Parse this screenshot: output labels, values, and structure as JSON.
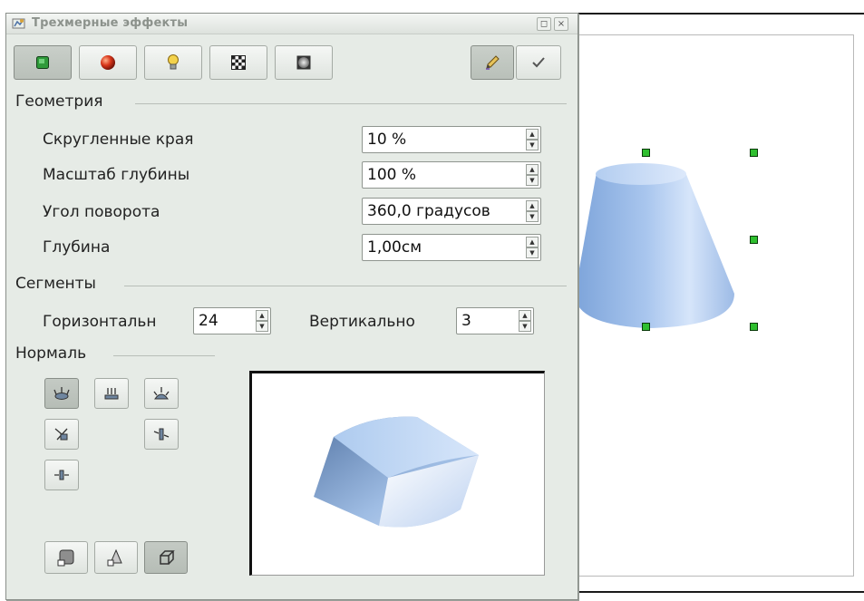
{
  "dialog": {
    "title": "Трехмерные эффекты",
    "window_buttons": {
      "restore": "◻",
      "close": "×"
    }
  },
  "toolbar": {
    "tabs": [
      {
        "name": "geometry",
        "icon": "cube-green-icon",
        "active": true
      },
      {
        "name": "shading",
        "icon": "sphere-red-icon",
        "active": false
      },
      {
        "name": "illumination",
        "icon": "lightbulb-icon",
        "active": false
      },
      {
        "name": "textures",
        "icon": "checker-texture-icon",
        "active": false
      },
      {
        "name": "material",
        "icon": "material-sphere-icon",
        "active": false
      }
    ],
    "right_buttons": [
      {
        "name": "update",
        "icon": "pencil-icon",
        "active": true
      },
      {
        "name": "assign",
        "icon": "checkmark-icon",
        "active": false
      }
    ]
  },
  "geometry": {
    "heading": "Геометрия",
    "rounded_edges": {
      "label": "Скругленные края",
      "value": "10 %"
    },
    "scaled_depth": {
      "label": "Масштаб глубины",
      "value": "100 %"
    },
    "rotation_angle": {
      "label": "Угол поворота",
      "value": "360,0 градусов"
    },
    "depth": {
      "label": "Глубина",
      "value": "1,00см"
    }
  },
  "segments": {
    "heading": "Сегменты",
    "horizontal": {
      "label": "Горизонтальн",
      "value": "24"
    },
    "vertical": {
      "label": "Вертикально",
      "value": "3"
    }
  },
  "normals": {
    "heading": "Нормаль"
  },
  "colors": {
    "dialog_bg": "#e6ebe6",
    "handle": "#2fbf2f",
    "shape_light": "#cfe0f7",
    "shape_dark": "#7fa6dc"
  }
}
